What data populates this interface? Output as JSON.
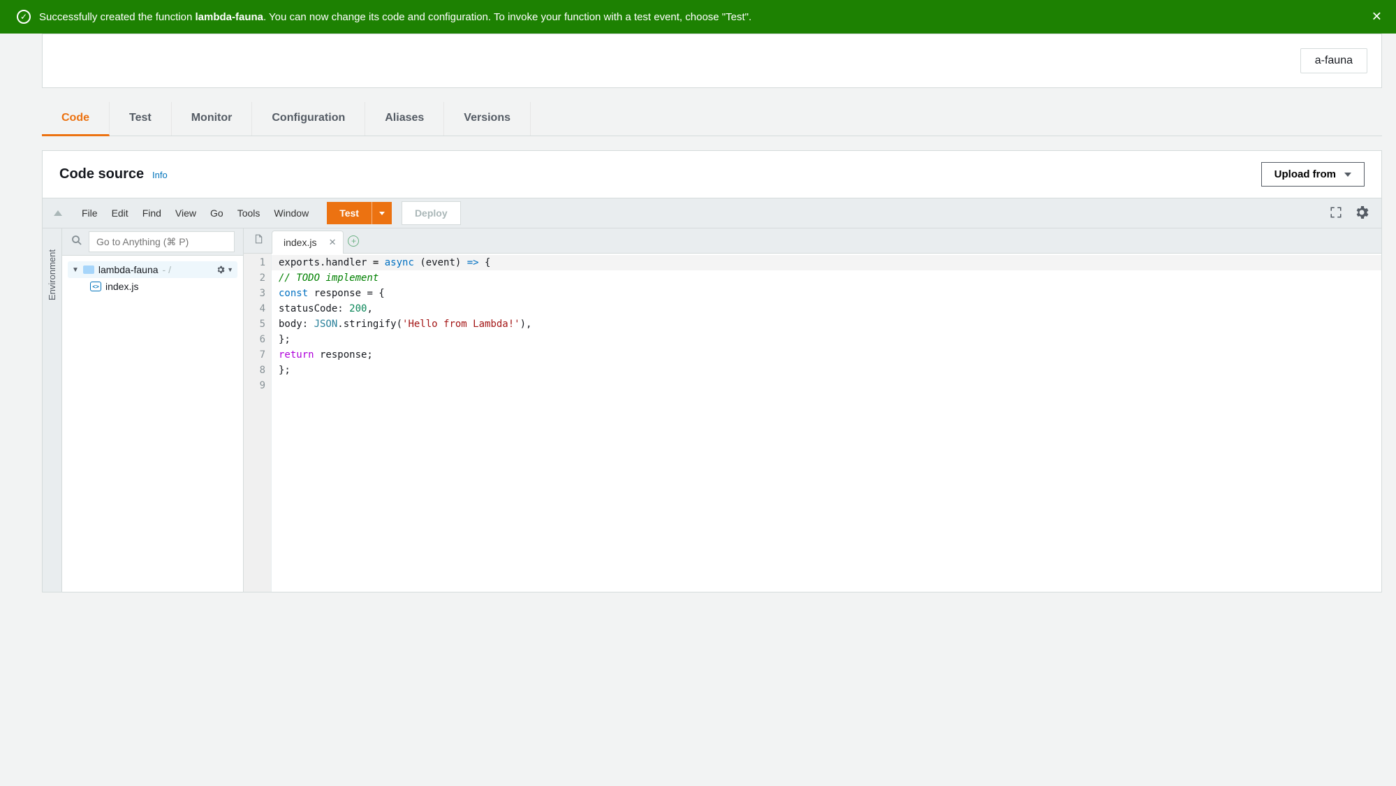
{
  "banner": {
    "text_prefix": "Successfully created the function ",
    "function_name": "lambda-fauna",
    "text_suffix": ". You can now change its code and configuration. To invoke your function with a test event, choose \"Test\"."
  },
  "top_badge": "a-fauna",
  "tabs": {
    "items": [
      "Code",
      "Test",
      "Monitor",
      "Configuration",
      "Aliases",
      "Versions"
    ],
    "active": "Code"
  },
  "panel": {
    "title": "Code source",
    "info_label": "Info",
    "upload_label": "Upload from"
  },
  "ide": {
    "menus": [
      "File",
      "Edit",
      "Find",
      "View",
      "Go",
      "Tools",
      "Window"
    ],
    "test_label": "Test",
    "deploy_label": "Deploy",
    "goto_placeholder": "Go to Anything (⌘ P)",
    "env_label": "Environment",
    "tree": {
      "folder": "lambda-fauna",
      "folder_suffix": "- /",
      "file": "index.js"
    },
    "open_tab": "index.js",
    "code_lines": [
      [
        {
          "t": "exports.handler ",
          "c": ""
        },
        {
          "t": "=",
          "c": "tok-op"
        },
        {
          "t": " ",
          "c": ""
        },
        {
          "t": "async",
          "c": "tok-async"
        },
        {
          "t": " (event) ",
          "c": ""
        },
        {
          "t": "=>",
          "c": "tok-arrow"
        },
        {
          "t": " {",
          "c": ""
        }
      ],
      [
        {
          "t": "    ",
          "c": ""
        },
        {
          "t": "// TODO implement",
          "c": "tok-comment"
        }
      ],
      [
        {
          "t": "    ",
          "c": ""
        },
        {
          "t": "const",
          "c": "tok-const"
        },
        {
          "t": " response = {",
          "c": ""
        }
      ],
      [
        {
          "t": "        statusCode: ",
          "c": ""
        },
        {
          "t": "200",
          "c": "tok-num"
        },
        {
          "t": ",",
          "c": ""
        }
      ],
      [
        {
          "t": "        body: ",
          "c": ""
        },
        {
          "t": "JSON",
          "c": "tok-json"
        },
        {
          "t": ".stringify(",
          "c": ""
        },
        {
          "t": "'Hello from Lambda!'",
          "c": "tok-str"
        },
        {
          "t": "),",
          "c": ""
        }
      ],
      [
        {
          "t": "    };",
          "c": ""
        }
      ],
      [
        {
          "t": "    ",
          "c": ""
        },
        {
          "t": "return",
          "c": "tok-return"
        },
        {
          "t": " response;",
          "c": ""
        }
      ],
      [
        {
          "t": "};",
          "c": ""
        }
      ],
      [
        {
          "t": "",
          "c": ""
        }
      ]
    ]
  }
}
